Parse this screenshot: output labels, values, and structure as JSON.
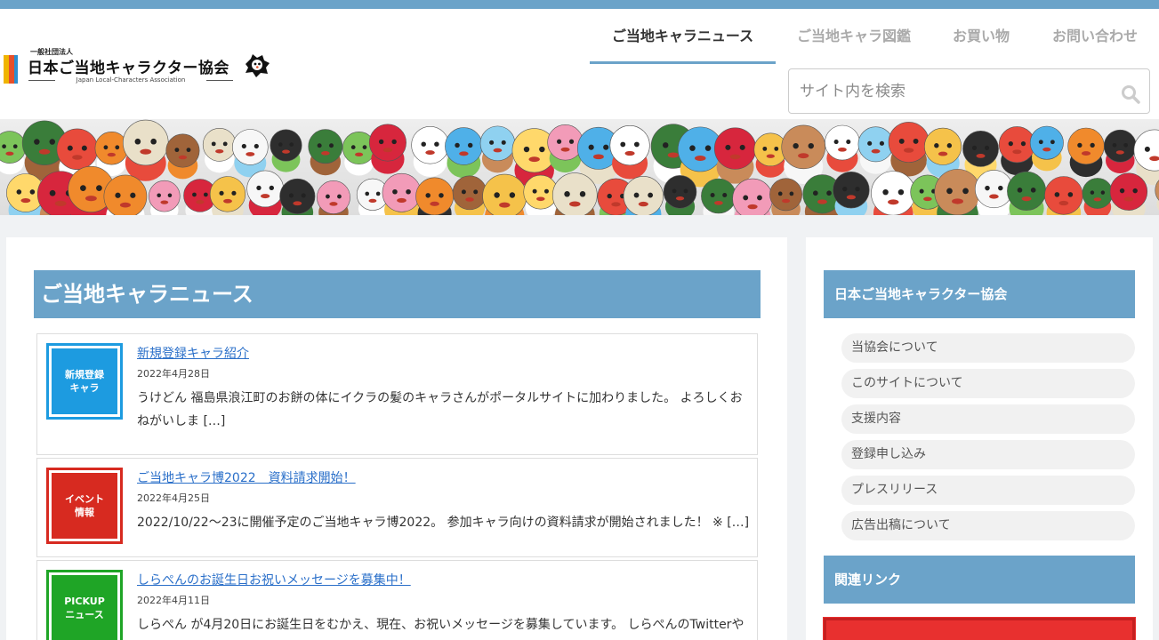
{
  "header": {
    "logo": {
      "sub": "一般社団法人",
      "main": "日本ご当地キャラクター協会",
      "en": "Japan Local-Characters Association"
    },
    "nav": [
      {
        "label": "ご当地キャラニュース",
        "active": true
      },
      {
        "label": "ご当地キャラ図鑑",
        "active": false
      },
      {
        "label": "お買い物",
        "active": false
      },
      {
        "label": "お問い合わせ",
        "active": false
      }
    ],
    "search": {
      "placeholder": "サイト内を検索"
    }
  },
  "main": {
    "title": "ご当地キャラニュース",
    "posts": [
      {
        "badge": "新規登録\nキャラ",
        "badge_color": "#1d9be0",
        "title": "新規登録キャラ紹介",
        "date": "2022年4月28日",
        "excerpt": "うけどん 福島県浪江町のお餅の体にイクラの髪のキャラさんがポータルサイトに加わりました。 よろしくおねがいしま […]"
      },
      {
        "badge": "イベント\n情報",
        "badge_color": "#d72a20",
        "title": "ご当地キャラ博2022　資料請求開始！",
        "date": "2022年4月25日",
        "excerpt": "2022/10/22～23に開催予定のご当地キャラ博2022。 参加キャラ向けの資料請求が開始されました！ ※ […]"
      },
      {
        "badge": "PICKUP\nニュース",
        "badge_color": "#1fa526",
        "title": "しらぺんのお誕生日お祝いメッセージを募集中！",
        "date": "2022年4月11日",
        "excerpt": "しらぺん が4月20日にお誕生日をむかえ、現在、お祝いメッセージを募集しています。 しらぺんのTwitterや"
      }
    ]
  },
  "sidebar": {
    "heading": "日本ご当地キャラクター協会",
    "items": [
      "当協会について",
      "このサイトについて",
      "支援内容",
      "登録申し込み",
      "プレスリリース",
      "広告出稿について"
    ],
    "links_heading": "関連リンク"
  },
  "colors": {
    "accent": "#6ba3c9",
    "link": "#2a6fc9"
  }
}
